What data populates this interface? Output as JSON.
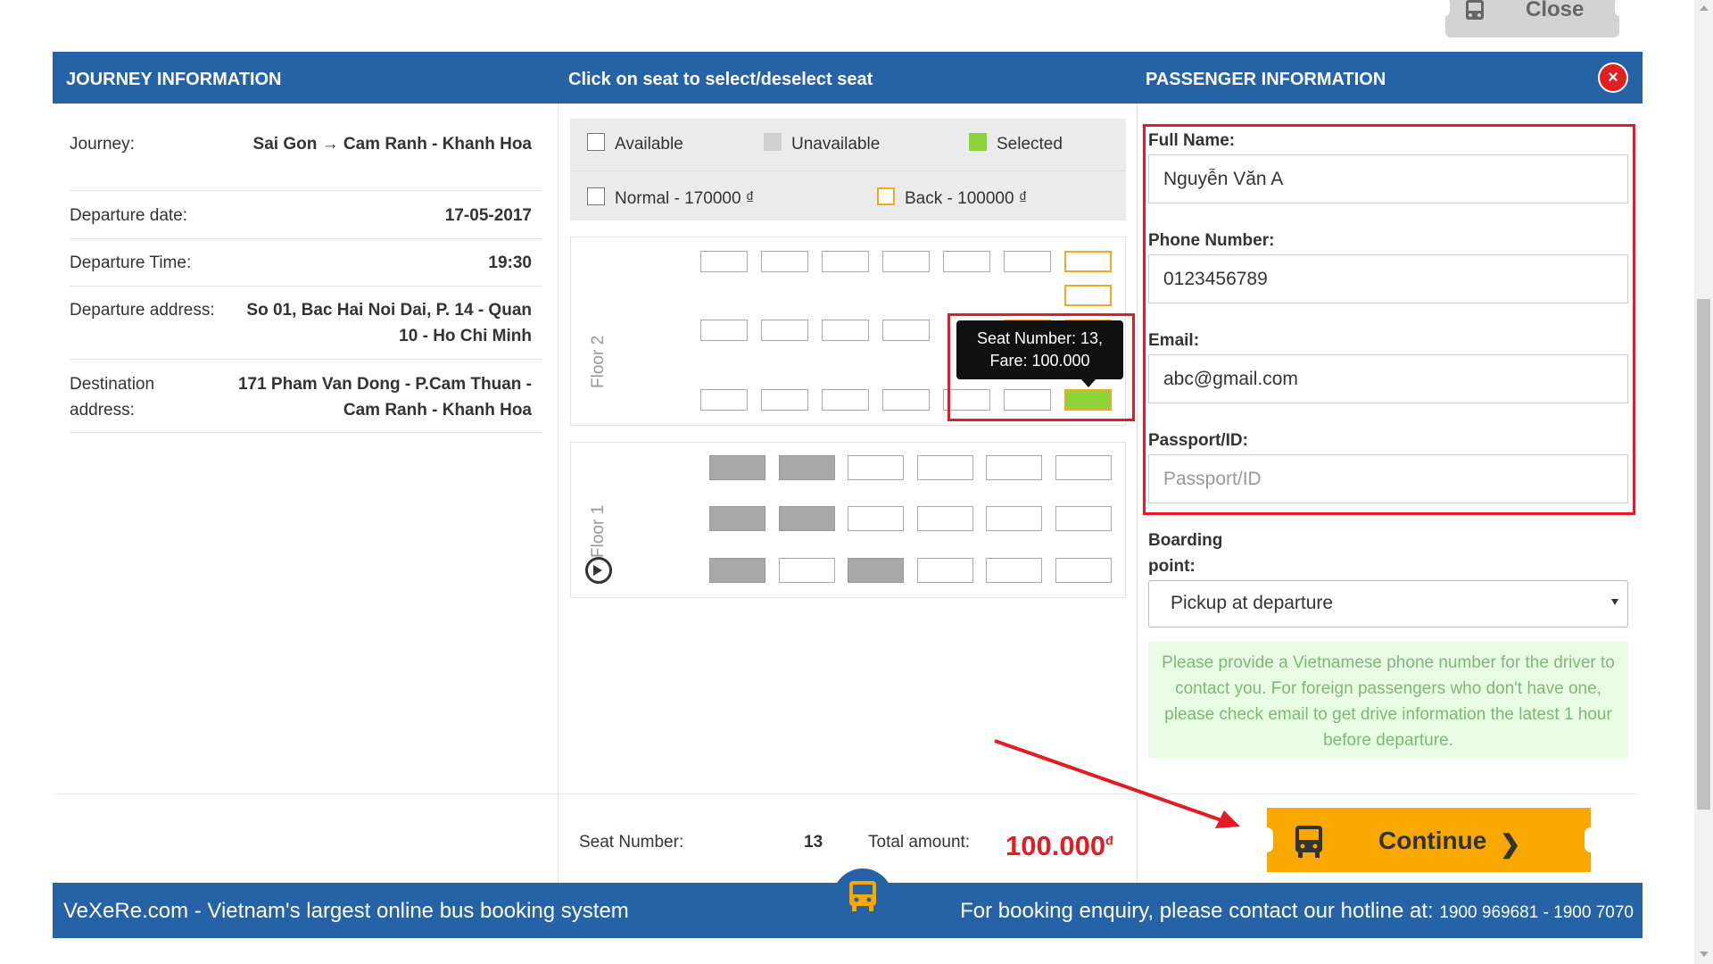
{
  "close_tab": {
    "label": "Close"
  },
  "header": {
    "journey_title": "JOURNEY INFORMATION",
    "seat_title": "Click on seat to select/deselect seat",
    "passenger_title": "PASSENGER INFORMATION",
    "close_symbol": "×"
  },
  "journey": {
    "rows": [
      {
        "label": "Journey:",
        "value": "Sai Gon → Cam Ranh - Khanh Hoa"
      },
      {
        "label": "Departure date:",
        "value": "17-05-2017"
      },
      {
        "label": "Departure Time:",
        "value": "19:30"
      },
      {
        "label": "Departure address:",
        "value": "So 01, Bac Hai Noi Dai, P. 14 - Quan 10 - Ho Chi Minh"
      },
      {
        "label": "Destination address:",
        "value": "171 Pham Van Dong - P.Cam Thuan - Cam Ranh - Khanh Hoa"
      }
    ]
  },
  "legend": {
    "available": "Available",
    "unavailable": "Unavailable",
    "selected": "Selected",
    "normal": "Normal - 170000 ₫",
    "back": "Back - 100000 ₫",
    "colors": {
      "selected": "#8fd33b",
      "back": "#f5a623",
      "unavailable": "#a8a8a8"
    }
  },
  "floors": {
    "floor2_label": "Floor 2",
    "floor1_label": "Floor 1",
    "floor2_rows": [
      [
        "available",
        "available",
        "available",
        "available",
        "available",
        "available",
        "back"
      ],
      [
        "back"
      ],
      [
        "available",
        "available",
        "available",
        "available",
        "hidden",
        "back",
        "back"
      ],
      [
        "available",
        "available",
        "available",
        "available",
        "available",
        "available",
        "selected"
      ]
    ],
    "floor1_rows": [
      [
        "unavailable",
        "unavailable",
        "available",
        "available",
        "available",
        "available"
      ],
      [
        "unavailable",
        "unavailable",
        "available",
        "available",
        "available",
        "available"
      ],
      [
        "unavailable",
        "available",
        "unavailable",
        "available",
        "available",
        "available"
      ]
    ]
  },
  "tooltip": {
    "line1": "Seat Number: 13,",
    "line2": "Fare: 100.000"
  },
  "passenger": {
    "full_name_label": "Full Name:",
    "full_name_value": "Nguyễn Văn A",
    "phone_label": "Phone Number:",
    "phone_value": "0123456789",
    "email_label": "Email:",
    "email_value": "abc@gmail.com",
    "passport_label": "Passport/ID:",
    "passport_placeholder": "Passport/ID",
    "boarding_label_1": "Boarding",
    "boarding_label_2": "point:",
    "boarding_value": "Pickup at departure",
    "notice": "Please provide a Vietnamese phone number for the driver to contact you. For foreign passengers who don't have one, please check email to get drive information the latest 1 hour before departure."
  },
  "summary": {
    "seat_number_label": "Seat Number:",
    "seat_number_value": "13",
    "total_label": "Total amount:",
    "total_value": "100.000",
    "currency": "đ",
    "continue_label": "Continue",
    "continue_chevron": "❯"
  },
  "footer": {
    "left": "VeXeRe.com - Vietnam's largest online bus booking system",
    "right_text": "For booking enquiry, please contact our hotline at:",
    "hotline": "1900 969681 - 1900 7070"
  }
}
